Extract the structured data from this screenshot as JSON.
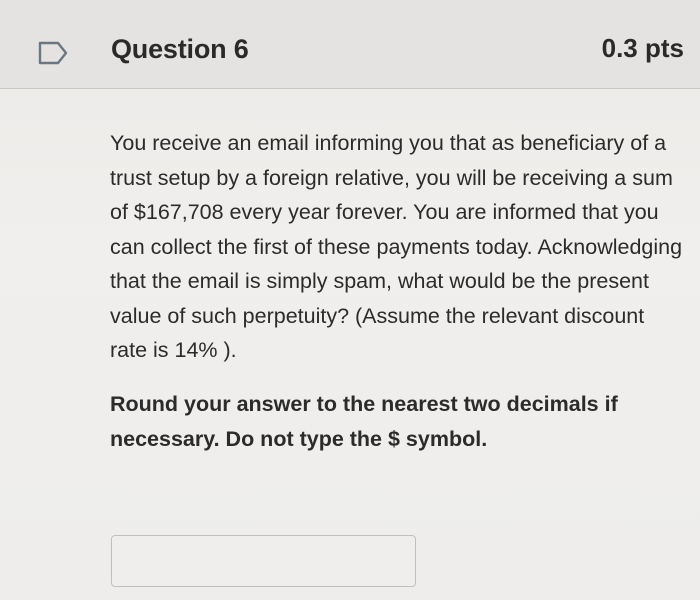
{
  "question": {
    "title": "Question 6",
    "points": "0.3 pts",
    "flag_icon": "bookmark-flag-icon",
    "text": "You receive an email informing you that as beneficiary of a trust setup by a foreign relative, you will be receiving a sum of $167,708 every year forever. You are informed that you can collect the first of these payments today. Acknowledging that the email is simply spam, what would be the present value of such perpetuity? (Assume the relevant discount rate is 14% ).",
    "instructions": "Round your answer to the nearest two decimals if necessary. Do not type the $ symbol.",
    "answer": {
      "value": "",
      "placeholder": ""
    }
  },
  "colors": {
    "header_bg": "#e4e3e1",
    "body_bg": "#eeedeb",
    "text": "#2b2b2b",
    "input_border": "#c2c0bd"
  }
}
